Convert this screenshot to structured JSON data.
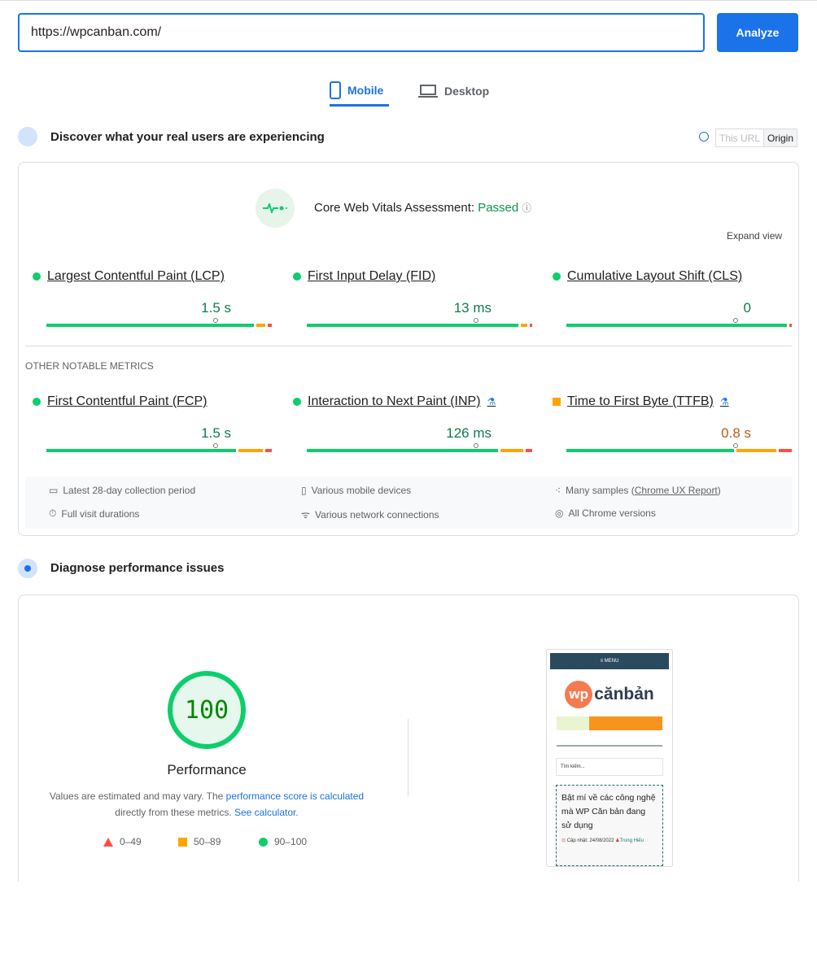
{
  "search": {
    "url": "https://wpcanban.com/",
    "analyze_label": "Analyze"
  },
  "tabs": [
    {
      "label": "Mobile",
      "active": true
    },
    {
      "label": "Desktop",
      "active": false
    }
  ],
  "field": {
    "title": "Discover what your real users are experiencing",
    "toggle": [
      "This URL",
      "Origin"
    ],
    "toggle_selected": "Origin",
    "assessment_label": "Core Web Vitals Assessment: ",
    "assessment_status": "Passed",
    "expand": "Expand view",
    "other_label": "OTHER NOTABLE METRICS",
    "metrics": [
      {
        "name": "Largest Contentful Paint (LCP)",
        "value": "1.5 s",
        "status": "good",
        "dist": [
          93,
          4,
          2
        ],
        "p75": 75,
        "lab": false
      },
      {
        "name": "First Input Delay (FID)",
        "value": "13 ms",
        "status": "good",
        "dist": [
          96,
          3,
          1
        ],
        "p75": 75,
        "lab": false
      },
      {
        "name": "Cumulative Layout Shift (CLS)",
        "value": "0",
        "status": "good",
        "dist": [
          99,
          0,
          1
        ],
        "p75": 75,
        "lab": false
      },
      {
        "name": "First Contentful Paint (FCP)",
        "value": "1.5 s",
        "status": "good",
        "dist": [
          86,
          11,
          3
        ],
        "p75": 75,
        "lab": false
      },
      {
        "name": "Interaction to Next Paint (INP)",
        "value": "126 ms",
        "status": "good",
        "dist": [
          86,
          10,
          3
        ],
        "p75": 75,
        "lab": true
      },
      {
        "name": "Time to First Byte (TTFB)",
        "value": "0.8 s",
        "status": "average",
        "dist": [
          76,
          18,
          6
        ],
        "p75": 75,
        "lab": true
      }
    ],
    "info": [
      "Latest 28-day collection period",
      "Various mobile devices",
      "Many samples (",
      "Chrome UX Report",
      ")",
      "Full visit durations",
      "Various network connections",
      "All Chrome versions"
    ]
  },
  "diagnose": {
    "title": "Diagnose performance issues",
    "score": "100",
    "score_label": "Performance",
    "desc1": "Values are estimated and may vary. The ",
    "desc_link1": "performance score is calculated",
    "desc2": "directly from these metrics. ",
    "desc_link2": "See calculator.",
    "legend": [
      "0–49",
      "50–89",
      "90–100"
    ]
  },
  "screenshot": {
    "menu": "≡ MENU",
    "logo_wp": "wp",
    "logo_text": "cănbản",
    "search": "Tìm kiếm...",
    "post_title": "Bật mí về các công nghệ mà WP Căn bản đang sử dụng",
    "meta_date": "Cập nhật: 24/08/2022",
    "meta_author": "Trung Hiếu"
  },
  "colors": {
    "accent": "#1a73e8",
    "good": "#0cce6b",
    "average": "#ffa400",
    "poor": "#ff4e42",
    "good_text": "#0d7d4a",
    "average_text": "#c33300"
  }
}
